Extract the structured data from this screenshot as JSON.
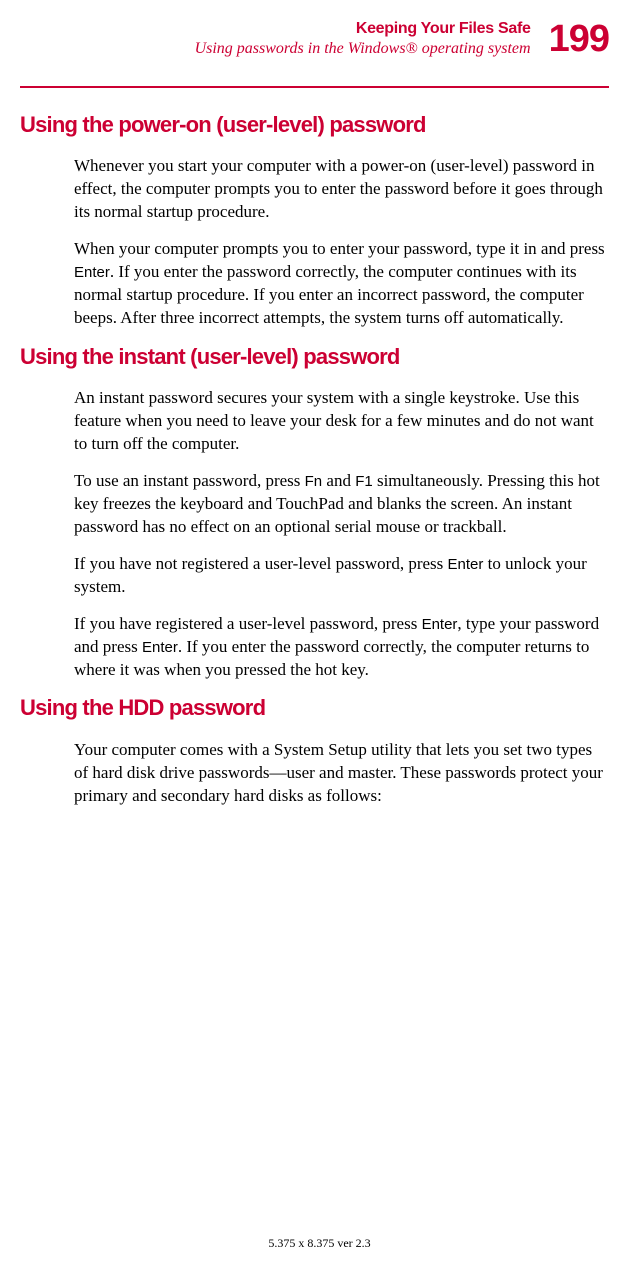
{
  "header": {
    "chapter_title": "Keeping Your Files Safe",
    "section_subtitle": "Using passwords in the Windows® operating system",
    "page_number": "199"
  },
  "sections": [
    {
      "heading": "Using the power-on (user-level) password",
      "paragraphs": [
        {
          "runs": [
            {
              "text": "Whenever you start your computer with a power-on (user-level) password in effect, the computer prompts you to enter the password before it goes through its normal startup procedure.",
              "key": false
            }
          ]
        },
        {
          "runs": [
            {
              "text": "When your computer prompts you to enter your password, type it in and press ",
              "key": false
            },
            {
              "text": "Enter",
              "key": true
            },
            {
              "text": ". If you enter the password correctly, the computer continues with its normal startup procedure. If you enter an incorrect password, the computer beeps. After three incorrect attempts, the system turns off automatically.",
              "key": false
            }
          ]
        }
      ]
    },
    {
      "heading": "Using the instant (user-level) password",
      "paragraphs": [
        {
          "runs": [
            {
              "text": "An instant password secures your system with a single keystroke. Use this feature when you need to leave your desk for a few minutes and do not want to turn off the computer.",
              "key": false
            }
          ]
        },
        {
          "runs": [
            {
              "text": "To use an instant password, press ",
              "key": false
            },
            {
              "text": "Fn",
              "key": true
            },
            {
              "text": " and ",
              "key": false
            },
            {
              "text": "F1",
              "key": true
            },
            {
              "text": " simultaneously. Pressing this hot key freezes the keyboard and TouchPad and blanks the screen. An instant password has no effect on an optional serial mouse or trackball.",
              "key": false
            }
          ]
        },
        {
          "runs": [
            {
              "text": "If you have not registered a user-level password, press ",
              "key": false
            },
            {
              "text": "Enter",
              "key": true
            },
            {
              "text": " to unlock your system.",
              "key": false
            }
          ]
        },
        {
          "runs": [
            {
              "text": "If you have registered a user-level password, press ",
              "key": false
            },
            {
              "text": "Enter",
              "key": true
            },
            {
              "text": ", type your password and press ",
              "key": false
            },
            {
              "text": "Enter",
              "key": true
            },
            {
              "text": ". If you enter the password correctly, the computer returns to where it was when you pressed the hot key.",
              "key": false
            }
          ]
        }
      ]
    },
    {
      "heading": "Using the HDD password",
      "paragraphs": [
        {
          "runs": [
            {
              "text": "Your computer comes with a System Setup utility that lets you set two types of hard disk drive passwords—user and master. These passwords protect your primary and secondary hard disks as follows:",
              "key": false
            }
          ]
        }
      ]
    }
  ],
  "footer": {
    "text": "5.375 x 8.375 ver 2.3"
  }
}
